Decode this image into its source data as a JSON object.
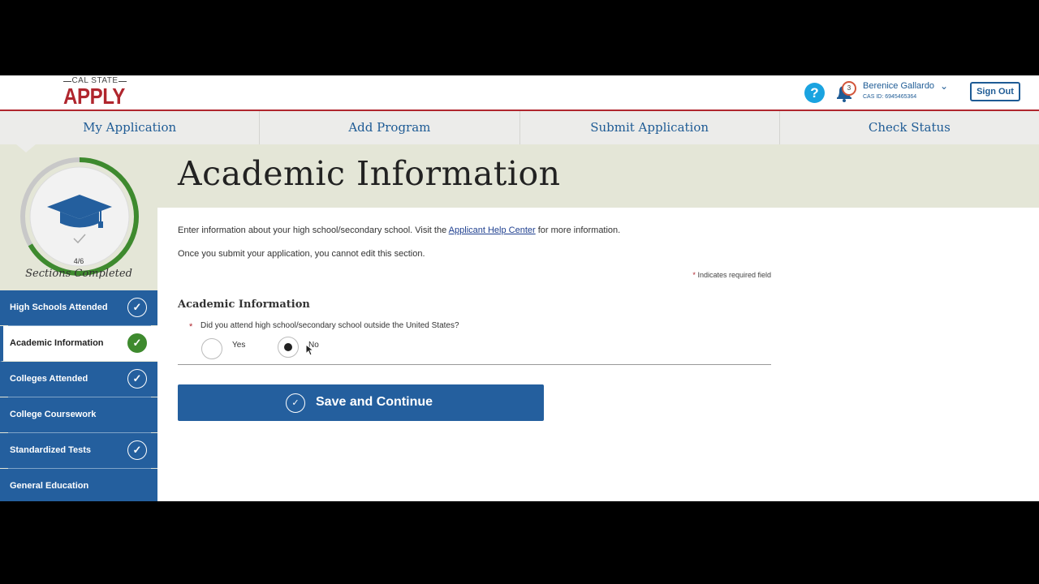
{
  "header": {
    "logo_top": "CAL STATE",
    "logo_bottom": "APPLY",
    "help_icon": "question-mark",
    "notification_count": "3",
    "user_name": "Berenice Gallardo",
    "cas_id": "CAS ID: 6945465364",
    "signout_label": "Sign Out"
  },
  "nav": {
    "tabs": [
      {
        "label": "My Application"
      },
      {
        "label": "Add Program"
      },
      {
        "label": "Submit Application"
      },
      {
        "label": "Check Status"
      }
    ]
  },
  "progress": {
    "count": "4/6",
    "label": "Sections Completed",
    "fraction": 0.6667
  },
  "sidebar": {
    "items": [
      {
        "label": "High Schools Attended",
        "completed": true
      },
      {
        "label": "Academic Information",
        "completed": true,
        "active": true
      },
      {
        "label": "Colleges Attended",
        "completed": true
      },
      {
        "label": "College Coursework",
        "completed": false
      },
      {
        "label": "Standardized Tests",
        "completed": true
      },
      {
        "label": "General Education",
        "completed": false
      }
    ]
  },
  "main": {
    "title": "Academic Information",
    "intro_before": "Enter information about your high school/secondary school. Visit the ",
    "intro_link": "Applicant Help Center",
    "intro_after": " for more information.",
    "notice": "Once you submit your application, you cannot edit this section.",
    "required_star": "*",
    "required_note": "Indicates required field",
    "section_title": "Academic Information",
    "question": "Did you attend high school/secondary school outside the United States?",
    "options": [
      {
        "label": "Yes",
        "selected": false
      },
      {
        "label": "No",
        "selected": true
      }
    ],
    "save_label": "Save and Continue"
  },
  "colors": {
    "brand_red": "#b0262e",
    "brand_blue": "#245f9e",
    "progress_green": "#3e8a2e",
    "band": "#e4e6d7"
  }
}
